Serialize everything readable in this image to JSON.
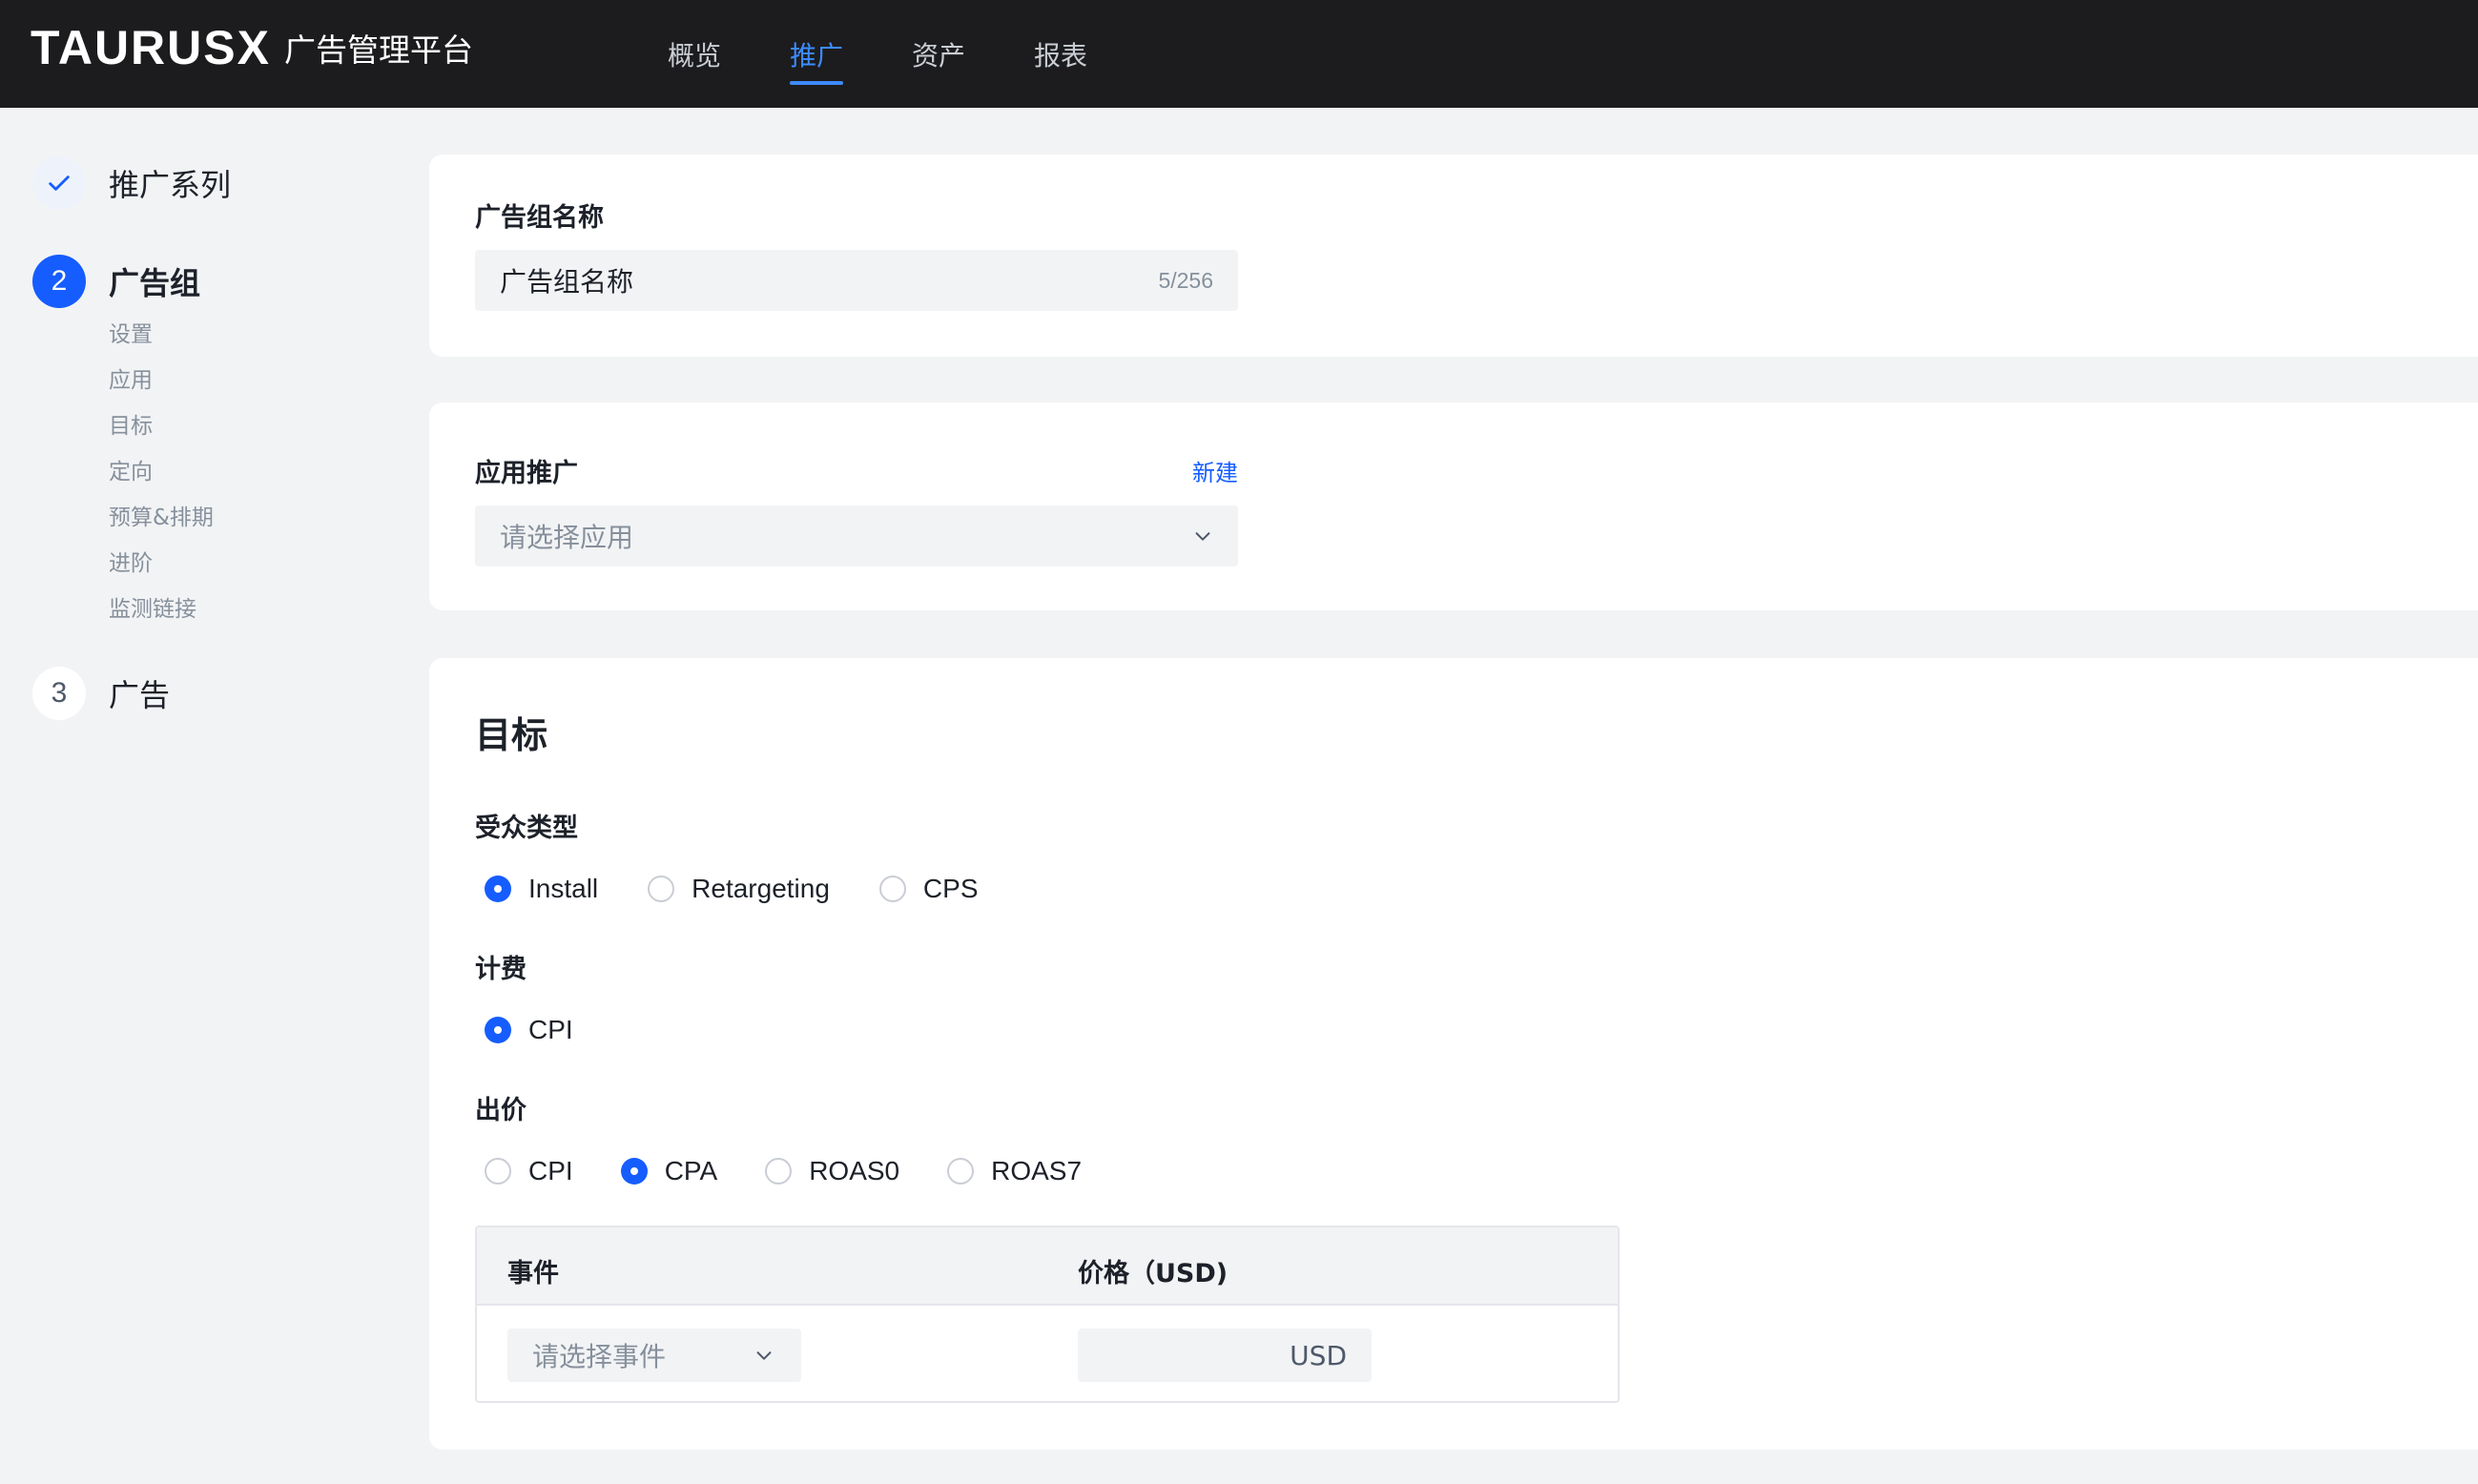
{
  "header": {
    "logo_text": "TAURUSX",
    "platform_name": "广告管理平台",
    "nav": [
      {
        "label": "概览",
        "active": false
      },
      {
        "label": "推广",
        "active": true
      },
      {
        "label": "资产",
        "active": false
      },
      {
        "label": "报表",
        "active": false
      }
    ]
  },
  "sidebar": {
    "steps": [
      {
        "indicator": "check-icon",
        "title": "推广系列",
        "state": "done"
      },
      {
        "indicator": "2",
        "title": "广告组",
        "state": "current"
      },
      {
        "indicator": "3",
        "title": "广告",
        "state": "todo"
      }
    ],
    "substeps": [
      "设置",
      "应用",
      "目标",
      "定向",
      "预算&排期",
      "进阶",
      "监测链接"
    ]
  },
  "adgroup_name": {
    "label": "广告组名称",
    "value": "广告组名称",
    "counter": "5/256"
  },
  "app_promo": {
    "label": "应用推广",
    "new_link": "新建",
    "placeholder": "请选择应用"
  },
  "goal": {
    "title": "目标",
    "audience": {
      "label": "受众类型",
      "options": [
        "Install",
        "Retargeting",
        "CPS"
      ],
      "selected": "Install"
    },
    "billing": {
      "label": "计费",
      "options": [
        "CPI"
      ],
      "selected": "CPI"
    },
    "bid": {
      "label": "出价",
      "options": [
        "CPI",
        "CPA",
        "ROAS0",
        "ROAS7"
      ],
      "selected": "CPA"
    },
    "table": {
      "col_event": "事件",
      "col_price": "价格（USD)",
      "event_placeholder": "请选择事件",
      "price_suffix": "USD"
    }
  },
  "colors": {
    "accent": "#165dff",
    "nav_active": "#3d8bff",
    "topbar_bg": "#1c1c1e",
    "page_bg": "#f2f3f5"
  }
}
